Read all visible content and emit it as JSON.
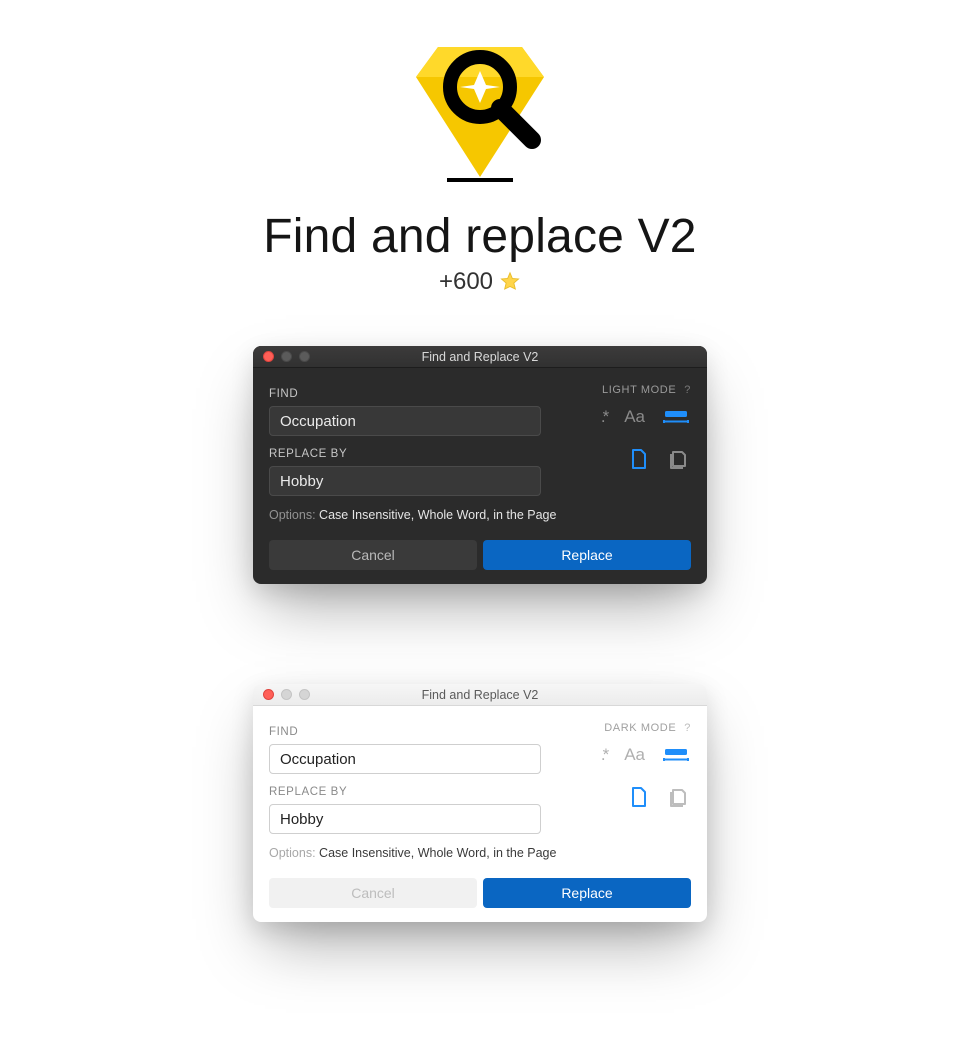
{
  "hero": {
    "title": "Find and replace V2",
    "subtitle": "+600",
    "star_name": "star-icon"
  },
  "window_title": "Find and Replace V2",
  "labels": {
    "find": "FIND",
    "replace": "REPLACE BY"
  },
  "fields": {
    "find_value": "Occupation",
    "replace_value": "Hobby"
  },
  "mode": {
    "light_label": "LIGHT MODE",
    "dark_label": "DARK MODE",
    "help_symbol": "?"
  },
  "icons": {
    "regex": ".*",
    "case": "Aa",
    "whole_word_name": "whole-word-icon",
    "active_color": "#1f8efa",
    "page_scope_name": "page-scope-icon",
    "doc_scope_name": "doc-scope-icon"
  },
  "options_line": {
    "prefix": "Options:",
    "value": "Case Insensitive, Whole Word, in the Page"
  },
  "buttons": {
    "cancel": "Cancel",
    "replace": "Replace"
  },
  "colors": {
    "primary": "#0a66c2",
    "accent": "#1f8efa",
    "brand_yellow": "#f6c700"
  }
}
